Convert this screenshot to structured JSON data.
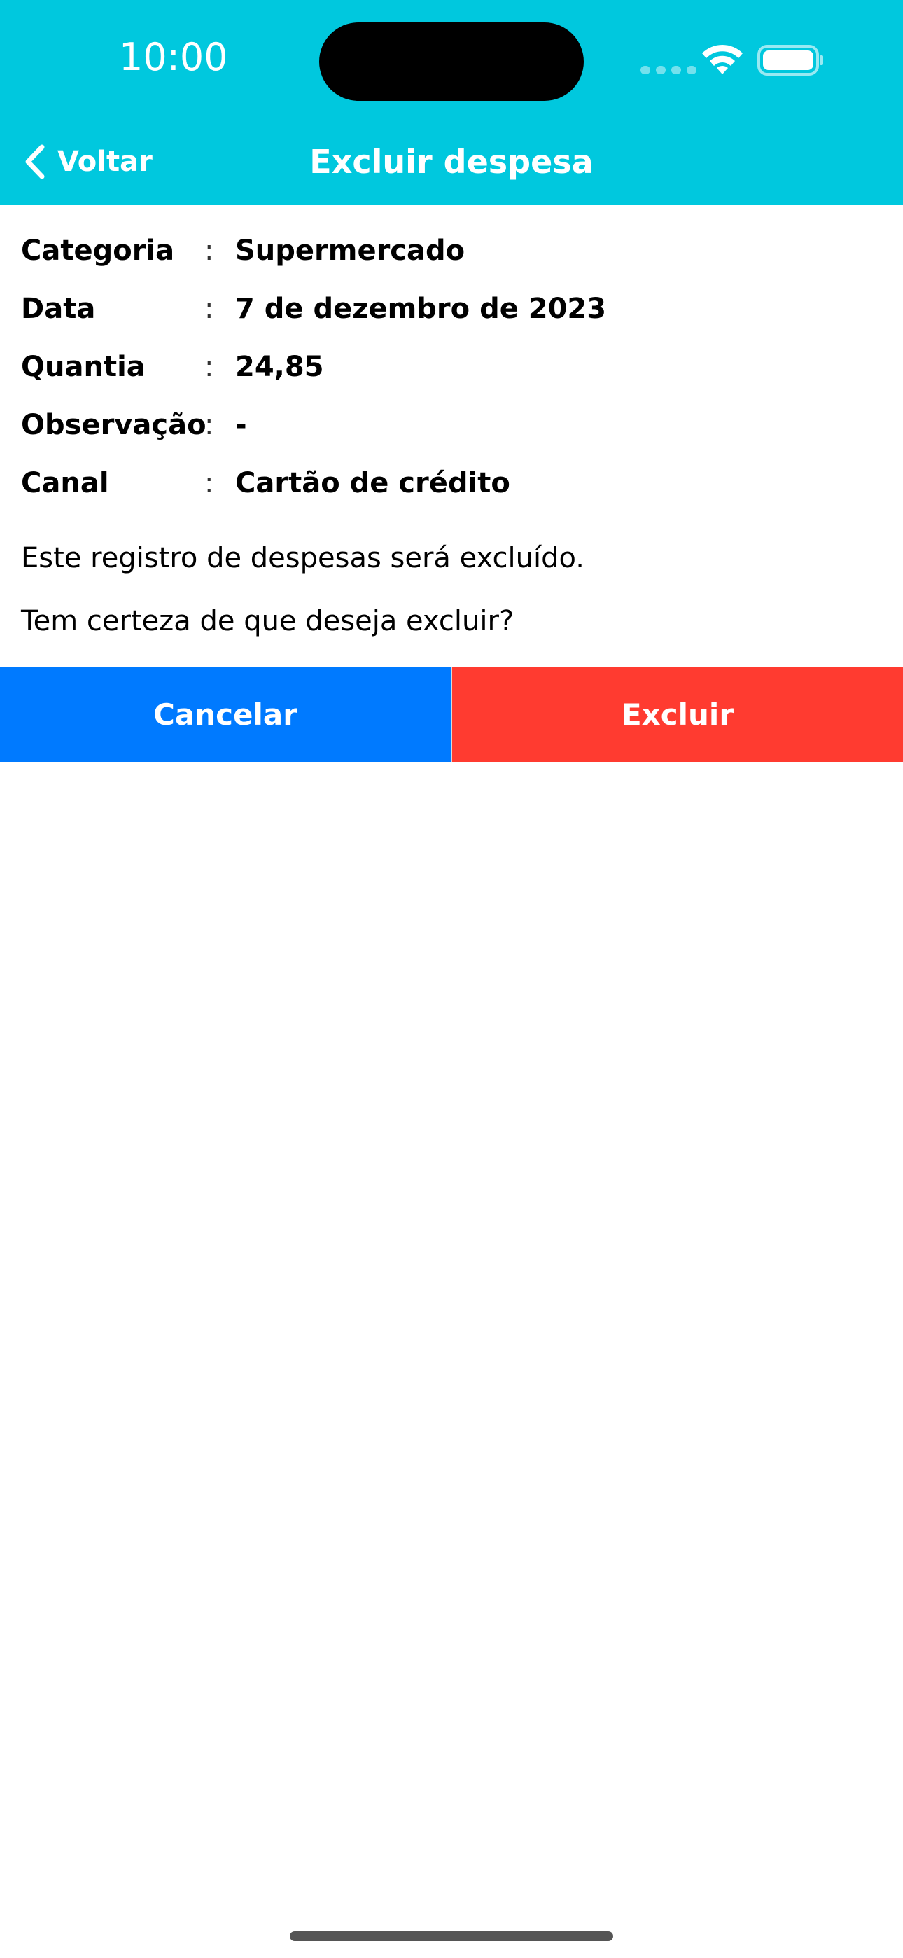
{
  "status_bar": {
    "time": "10:00"
  },
  "nav": {
    "back_label": "Voltar",
    "title": "Excluir despesa"
  },
  "details": [
    {
      "label": "Categoria",
      "separator": ":",
      "value": "Supermercado"
    },
    {
      "label": "Data",
      "separator": ":",
      "value": "7 de dezembro de 2023"
    },
    {
      "label": "Quantia",
      "separator": ":",
      "value": "24,85"
    },
    {
      "label": "Observação",
      "separator": ":",
      "value": "-"
    },
    {
      "label": "Canal",
      "separator": ":",
      "value": "Cartão de crédito"
    }
  ],
  "messages": {
    "line1": "Este registro de despesas será excluído.",
    "line2": "Tem certeza de que deseja excluir?"
  },
  "actions": {
    "cancel_label": "Cancelar",
    "delete_label": "Excluir"
  },
  "colors": {
    "header": "#00C8DE",
    "cancel": "#007AFF",
    "delete": "#FF3B30"
  },
  "icons": {
    "back": "chevron-left-icon",
    "wifi": "wifi-icon",
    "battery": "battery-icon"
  }
}
